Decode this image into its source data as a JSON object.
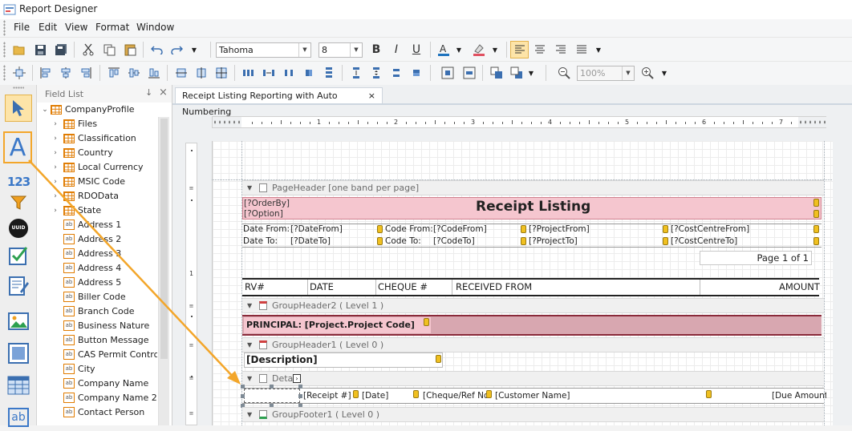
{
  "window": {
    "title": "Report Designer"
  },
  "menu": [
    "File",
    "Edit",
    "View",
    "Format",
    "Window"
  ],
  "font": {
    "name": "Tahoma",
    "size": "8"
  },
  "zoom": "100%",
  "field_list": {
    "title": "Field List",
    "pin": "↓",
    "close": "×",
    "root": "CompanyProfile",
    "tables": [
      "Files",
      "Classification",
      "Country",
      "Local Currency",
      "MSIC Code",
      "RDOData",
      "State"
    ],
    "fields": [
      "Address 1",
      "Address 2",
      "Address 3",
      "Address 4",
      "Address 5",
      "Biller Code",
      "Branch Code",
      "Business Nature",
      "Button Message",
      "CAS Permit Control N",
      "City",
      "Company Name",
      "Company Name 2",
      "Contact Person"
    ],
    "field_icon_text": "ab"
  },
  "toolbox": {
    "items": [
      "pointer-tool",
      "label-tool",
      "number-tool",
      "filter-tool",
      "uuid-tool",
      "checkbox-tool",
      "richtext-tool",
      "picture-tool",
      "panel-tool",
      "table-tool",
      "field-tool"
    ],
    "label_glyph": "A",
    "number_glyph": "123",
    "uuid_glyph": "UUID",
    "field_glyph": "ab"
  },
  "document": {
    "tab_title": "Receipt Listing Reporting with Auto Numbering",
    "tab_close": "×",
    "ruler_numbers": [
      "1",
      "2",
      "3",
      "4",
      "5",
      "6",
      "7"
    ],
    "vruler_number": "1",
    "bands": {
      "page_header": "PageHeader [one band per page]",
      "group_header2": "GroupHeader2 ( Level 1 )",
      "group_header1": "GroupHeader1 ( Level 0 )",
      "detail": "Detail",
      "group_footer1": "GroupFooter1 ( Level 0 )"
    },
    "report_title": "Receipt Listing",
    "order_by": "[?OrderBy]",
    "option": "[?Option]",
    "filters": {
      "date_from_label": "Date From:",
      "date_from_value": "[?DateFrom]",
      "date_to_label": "Date To:",
      "date_to_value": "[?DateTo]",
      "code_from_label": "Code From:",
      "code_from_value": "[?CodeFrom]",
      "code_to_label": "Code To:",
      "code_to_value": "[?CodeTo]",
      "project_from": "[?ProjectFrom]",
      "project_to": "[?ProjectTo]",
      "cost_centre_from": "[?CostCentreFrom]",
      "cost_centre_to": "[?CostCentreTo]"
    },
    "page_number": "Page 1 of 1",
    "columns": [
      "RV#",
      "DATE",
      "CHEQUE #",
      "RECEIVED FROM",
      "AMOUNT"
    ],
    "principal": "PRINCIPAL: [Project.Project Code]",
    "description": "[Description]",
    "detail_fields": [
      "[Receipt #]",
      "[Date]",
      "[Cheque/Ref No]",
      "[Customer Name]",
      "[Due Amount]"
    ]
  },
  "colors": {
    "highlight_band": "#f5c6cf",
    "annotation": "#f3a62a",
    "accent": "#1e73be"
  }
}
